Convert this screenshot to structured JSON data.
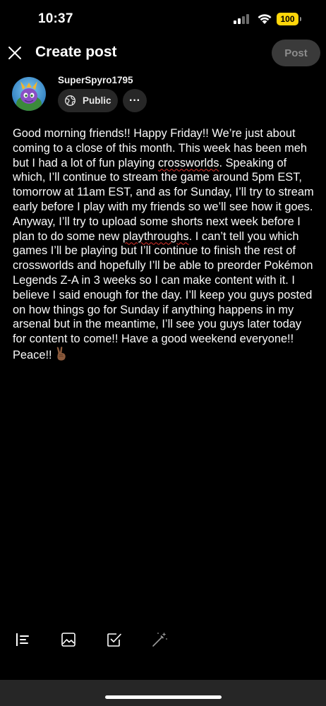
{
  "status_bar": {
    "time": "10:37",
    "battery_level": "100",
    "icons": [
      "signal-icon",
      "wifi-icon",
      "battery-icon"
    ]
  },
  "header": {
    "title": "Create post",
    "post_label": "Post",
    "close_icon": "close-icon"
  },
  "author": {
    "username": "SuperSpyro1795",
    "visibility": "Public",
    "visibility_icon": "globe-icon",
    "more_label": "···"
  },
  "post": {
    "segments": [
      "Good morning friends!! Happy Friday!! We’re just about coming to a close of this month. This week has been meh but I had a lot of fun playing ",
      "crossworlds",
      ". Speaking of which, I’ll continue to stream the game around 5pm EST, tomorrow at 11am EST, and as for Sunday, I’ll try to stream early before I play with my friends so we’ll see how it goes. Anyway, I’ll try to upload some shorts next week before I plan to do some new ",
      "playthroughs",
      ". I can’t tell you which games I’ll be playing but I’ll continue to finish the rest of crossworlds and hopefully I’ll be able to preorder Pokémon Legends Z-A in 3 weeks so I can make content with it. I believe I said enough for the day. I’ll keep you guys posted on how things go for Sunday if anything happens in my arsenal but in the meantime, I’ll see you guys later today for content to come!! Have a good weekend everyone!! Peace!! "
    ],
    "emoji": "victory-hand-emoji"
  },
  "toolbar": {
    "tools": [
      "text-format-icon",
      "image-icon",
      "poll-icon",
      "magic-wand-icon"
    ]
  },
  "colors": {
    "background": "#000000",
    "chip": "#272727",
    "post_button": "#3a3a3a",
    "battery": "#ffd60a",
    "spellcheck": "#e0322c"
  }
}
